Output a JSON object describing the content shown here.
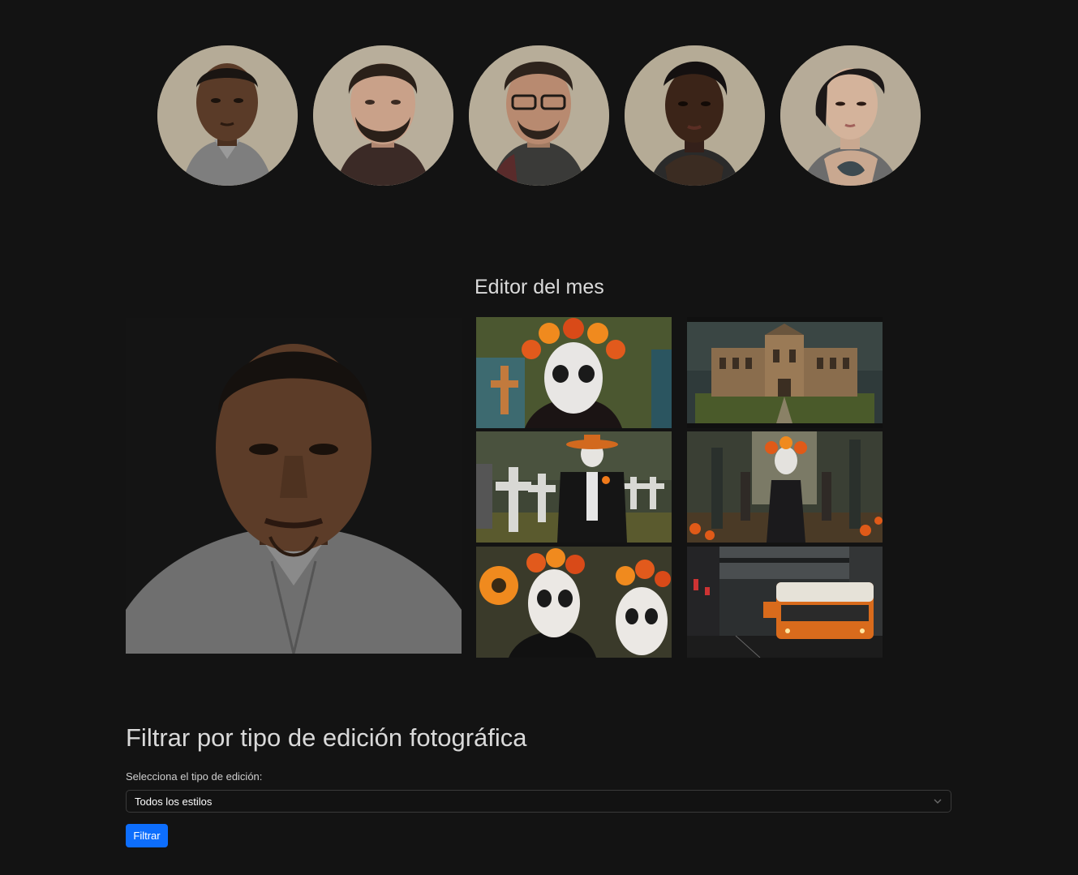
{
  "avatars": [
    {
      "name": "portrait-man-1",
      "bg": "#b5ab97",
      "skin": "#5a3b28",
      "hair": "#1a1512",
      "shirt": "#8a8a8a"
    },
    {
      "name": "portrait-man-2",
      "bg": "#b8ae9b",
      "skin": "#c9a189",
      "hair": "#2a2019",
      "shirt": "#3b2a26"
    },
    {
      "name": "portrait-man-3",
      "bg": "#b7ad99",
      "skin": "#b88a70",
      "hair": "#2d231c",
      "shirt": "#3a3a38"
    },
    {
      "name": "portrait-woman-1",
      "bg": "#b5ab96",
      "skin": "#3b2418",
      "hair": "#141010",
      "shirt": "#2a2a2a"
    },
    {
      "name": "portrait-woman-2",
      "bg": "#b6ab98",
      "skin": "#d4b39b",
      "hair": "#1c1818",
      "shirt": "#6c6c6c"
    }
  ],
  "editor": {
    "title": "Editor del mes"
  },
  "gallery": [
    {
      "name": "catrina-flower-crown-photo",
      "theme": "catrina"
    },
    {
      "name": "mansion-photo",
      "theme": "mansion"
    },
    {
      "name": "catrin-cemetery-photo",
      "theme": "catrin"
    },
    {
      "name": "catrina-park-photo",
      "theme": "park"
    },
    {
      "name": "sugar-skull-couple-photo",
      "theme": "skulls"
    },
    {
      "name": "city-tram-photo",
      "theme": "tram"
    }
  ],
  "filter": {
    "title": "Filtrar por tipo de edición fotográfica",
    "label": "Selecciona el tipo de edición:",
    "selected": "Todos los estilos",
    "button": "Filtrar"
  },
  "colors": {
    "background": "#131313",
    "accent": "#0d6efd"
  }
}
